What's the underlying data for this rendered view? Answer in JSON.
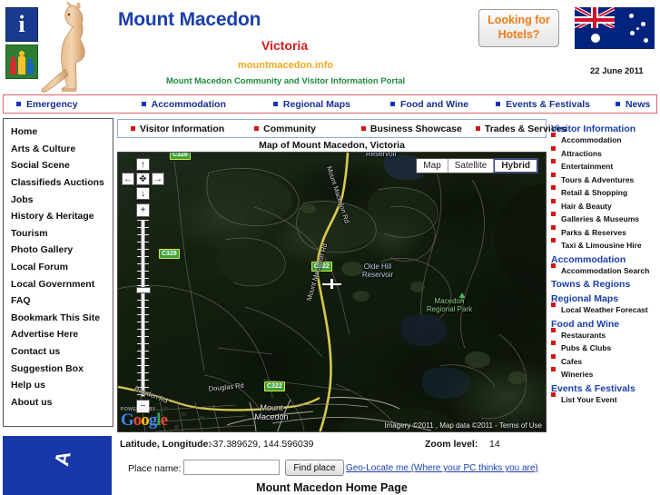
{
  "header": {
    "site_title": "Mount Macedon",
    "state": "Victoria",
    "url": "mountmacedon.info",
    "tagline": "Mount Macedon Community and Visitor Information Portal",
    "hotels_button_line1": "Looking for",
    "hotels_button_line2": "Hotels?",
    "date": "22 June 2011",
    "info_icon_glyph": "i",
    "colors": {
      "title_blue": "#1a3faa",
      "state_red": "#d81b1b",
      "url_orange": "#f0a81e",
      "tagline_green": "#1b8a3f",
      "hotels_orange": "#f07c18"
    }
  },
  "topnav": {
    "items": [
      {
        "label": "Emergency"
      },
      {
        "label": "Accommodation"
      },
      {
        "label": "Regional Maps"
      },
      {
        "label": "Food and Wine"
      },
      {
        "label": "Events & Festivals"
      },
      {
        "label": "News"
      }
    ]
  },
  "subnav": {
    "items": [
      {
        "label": "Visitor Information"
      },
      {
        "label": "Community"
      },
      {
        "label": "Business Showcase"
      },
      {
        "label": "Trades & Services"
      }
    ]
  },
  "leftbar": {
    "items": [
      {
        "label": "Home"
      },
      {
        "label": "Arts & Culture"
      },
      {
        "label": "Social Scene"
      },
      {
        "label": "Classifieds Auctions"
      },
      {
        "label": "Jobs"
      },
      {
        "label": "History & Heritage"
      },
      {
        "label": "Tourism"
      },
      {
        "label": "Photo Gallery"
      },
      {
        "label": "Local Forum"
      },
      {
        "label": "Local Government"
      },
      {
        "label": "FAQ"
      },
      {
        "label": "Bookmark This Site"
      },
      {
        "label": "Advertise Here"
      },
      {
        "label": "Contact us"
      },
      {
        "label": "Suggestion Box"
      },
      {
        "label": "Help us"
      },
      {
        "label": "About us"
      }
    ],
    "ad_text": "A"
  },
  "map": {
    "title": "Map of Mount Macedon, Victoria",
    "types": [
      {
        "label": "Map",
        "selected": false
      },
      {
        "label": "Satellite",
        "selected": false
      },
      {
        "label": "Hybrid",
        "selected": true
      }
    ],
    "controls": {
      "pan_up": "↑",
      "pan_left": "←",
      "pan_center": "✥",
      "pan_right": "→",
      "pan_down": "↓",
      "zoom_in": "+",
      "zoom_out": "−"
    },
    "labels": [
      {
        "text": "Reservoir",
        "kind": "water"
      },
      {
        "text": "Olde Hill\nReservoir",
        "kind": "water"
      },
      {
        "text": "Macedon\nRegional Park",
        "kind": "park"
      },
      {
        "text": "Mount Macedon Rd",
        "kind": "road"
      },
      {
        "text": "Mount Macedon Rd",
        "kind": "road"
      },
      {
        "text": "Bawden Rd",
        "kind": "road"
      },
      {
        "text": "Douglas Rd",
        "kind": "road"
      },
      {
        "text": "Mount\nMacedon",
        "kind": "place"
      }
    ],
    "shields": [
      {
        "label": "C328"
      },
      {
        "label": "C328"
      },
      {
        "label": "C322"
      },
      {
        "label": "C322"
      }
    ],
    "google_credit_powered": "POWERED BY",
    "google_letters": [
      "G",
      "o",
      "o",
      "g",
      "l",
      "e"
    ],
    "attribution": "Imagery ©2011 , Map data ©2011 - Terms of Use"
  },
  "mapinfo": {
    "latlong_label": "Latitude, Longitude:",
    "latlong_value": "-37.389629, 144.596039",
    "zoom_label": "Zoom level:",
    "zoom_value": "14",
    "place_label": "Place name:",
    "place_value": "",
    "place_placeholder": "",
    "find_button": "Find place",
    "geolocate_link": "Geo-Locate me (Where your PC thinks you are)",
    "home_page_title": "Mount Macedon Home Page"
  },
  "rightbar": {
    "sections": [
      {
        "heading": "Visitor Information",
        "items": [
          {
            "label": "Accommodation"
          },
          {
            "label": "Attractions"
          },
          {
            "label": "Entertainment"
          },
          {
            "label": "Tours & Adventures"
          },
          {
            "label": "Retail & Shopping"
          },
          {
            "label": "Hair & Beauty"
          },
          {
            "label": "Galleries & Museums"
          },
          {
            "label": "Parks & Reserves"
          },
          {
            "label": "Taxi & Limousine Hire"
          }
        ]
      },
      {
        "heading": "Accommodation",
        "items": [
          {
            "label": "Accommodation Search"
          }
        ]
      },
      {
        "heading": "Towns & Regions",
        "items": []
      },
      {
        "heading": "Regional Maps",
        "items": [
          {
            "label": "Local Weather Forecast"
          }
        ]
      },
      {
        "heading": "Food and Wine",
        "items": [
          {
            "label": "Restaurants"
          },
          {
            "label": "Pubs & Clubs"
          },
          {
            "label": "Cafes"
          },
          {
            "label": "Wineries"
          }
        ]
      },
      {
        "heading": "Events & Festivals",
        "items": [
          {
            "label": "List Your Event"
          }
        ]
      }
    ]
  }
}
